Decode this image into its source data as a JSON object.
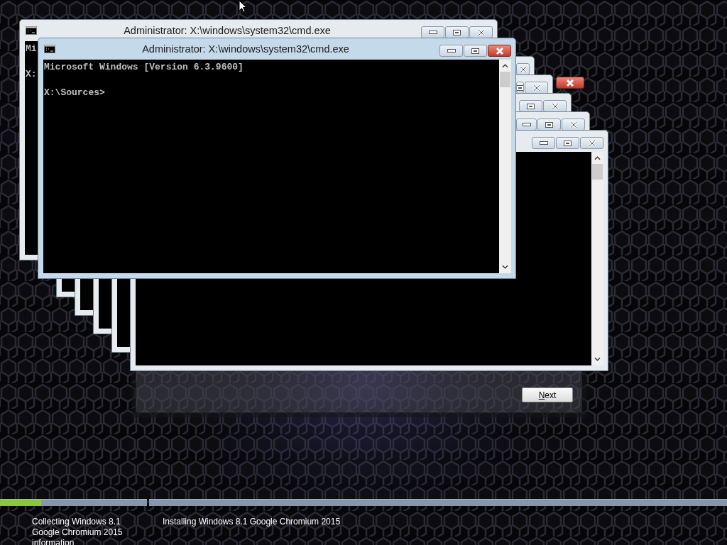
{
  "cascade_windows": [
    {
      "kind": "cmd"
    },
    {
      "kind": "cmd"
    },
    {
      "kind": "cmd"
    },
    {
      "kind": "cmd"
    },
    {
      "kind": "cmd"
    }
  ],
  "windows": [
    {
      "title": "Administrator: X:\\windows\\system32\\cmd.exe",
      "active": false,
      "lines": [
        "Mi"
      ],
      "prompt": "X:"
    },
    {
      "title": "Administrator: X:\\windows\\system32\\cmd.exe",
      "active": true,
      "lines": [
        "Microsoft Windows [Version 6.3.9600]"
      ],
      "prompt": "X:\\Sources>"
    }
  ],
  "setup": {
    "next_button": "Next"
  },
  "progress_steps": [
    {
      "label": "Collecting Windows 8.1 Google Chromium 2015 information",
      "level": 0.28
    },
    {
      "label": "Installing Windows 8.1 Google Chromium 2015"
    }
  ]
}
